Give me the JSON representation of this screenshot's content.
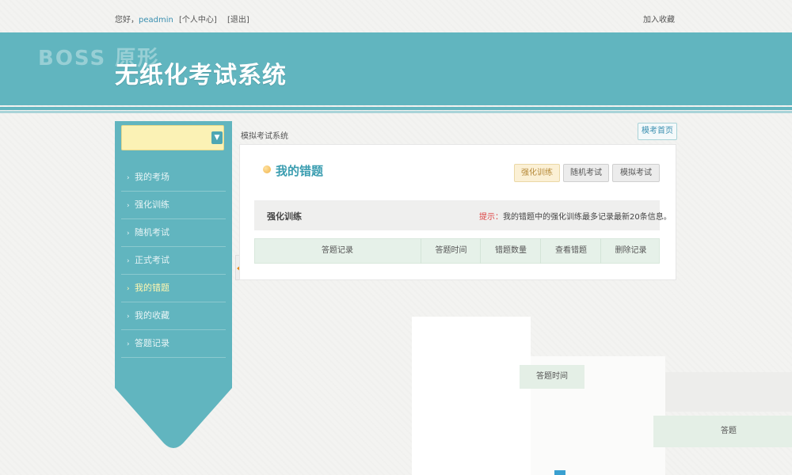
{
  "topbar": {
    "greeting": "您好，",
    "username": "peadmin",
    "profile_link": "[个人中心]",
    "logout_link": "[退出]",
    "favorite_link": "加入收藏"
  },
  "banner": {
    "watermark": "BOSS 原形",
    "title": "无纸化考试系统"
  },
  "sidebar": {
    "select_value": "",
    "items": [
      {
        "label": "我的考场",
        "active": false
      },
      {
        "label": "强化训练",
        "active": false
      },
      {
        "label": "随机考试",
        "active": false
      },
      {
        "label": "正式考试",
        "active": false
      },
      {
        "label": "我的错题",
        "active": true
      },
      {
        "label": "我的收藏",
        "active": false
      },
      {
        "label": "答题记录",
        "active": false
      }
    ]
  },
  "breadcrumb": "模拟考试系统",
  "home_button": "模考首页",
  "panel": {
    "title": "我的错题",
    "modes": [
      "强化训练",
      "随机考试",
      "模拟考试"
    ],
    "active_mode": "强化训练",
    "section_title": "强化训练",
    "tip_label": "提示：",
    "tip_text": "我的错题中的强化训练最多记录最新20条信息。",
    "columns": [
      "答题记录",
      "答题时间",
      "错题数量",
      "查看错题",
      "删除记录"
    ]
  },
  "fragment": {
    "cell_a": "答题时间",
    "cell_b": "答题"
  },
  "colors": {
    "brand": "#61b5bf",
    "active_nav": "#fff7b0",
    "title_accent": "#3a9db0",
    "tip_red": "#dd4444"
  }
}
